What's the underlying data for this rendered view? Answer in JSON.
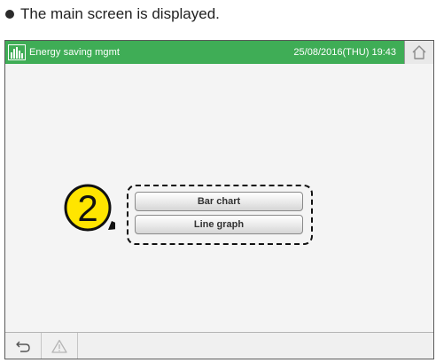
{
  "caption": "The main screen is displayed.",
  "header": {
    "title": "Energy saving mgmt",
    "datetime": "25/08/2016(THU) 19:43",
    "background": "#3fad56"
  },
  "buttons": {
    "bar_chart": "Bar chart",
    "line_graph": "Line graph"
  },
  "step_badge": {
    "number": "2",
    "fill": "#ffe500"
  },
  "icons": {
    "app": "bar-chart-icon",
    "home": "home-icon",
    "back": "back-arrow-icon",
    "warning": "warning-icon"
  }
}
